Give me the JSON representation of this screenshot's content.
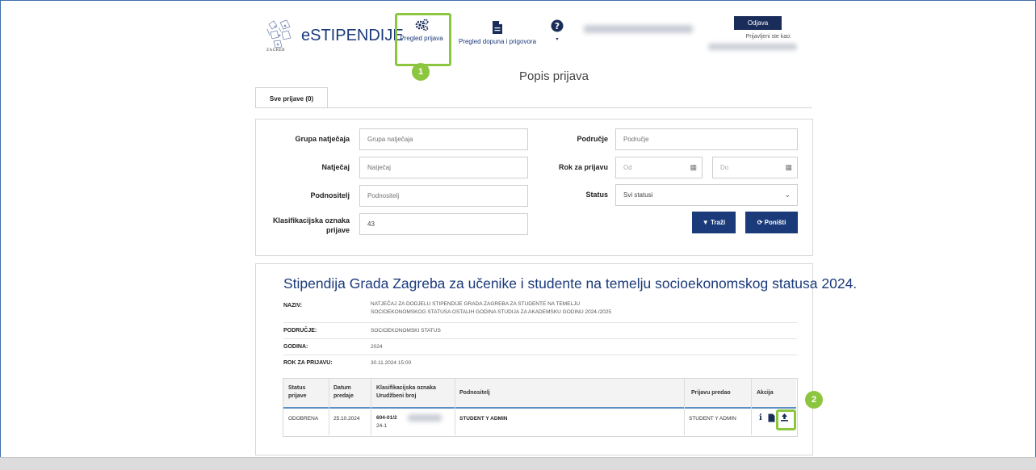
{
  "header": {
    "app_title": "eSTIPENDIJE",
    "city_logo_text": "ZAGREB",
    "nav": [
      {
        "label": "Pregled prijava",
        "icon": "gears-icon"
      },
      {
        "label": "Pregled dopuna i prigovora",
        "icon": "document-icon"
      },
      {
        "label": "",
        "icon": "help-icon"
      }
    ],
    "logout_label": "Odjava",
    "logged_in_label": "Prijavljeni ste kao:"
  },
  "callouts": [
    "1",
    "2"
  ],
  "page_title": "Popis prijava",
  "tabs": [
    {
      "label": "Sve prijave (0)"
    }
  ],
  "filters": {
    "grupa": {
      "label": "Grupa natječaja",
      "placeholder": "Grupa natječaja"
    },
    "natjecaj": {
      "label": "Natječaj",
      "placeholder": "Natječaj"
    },
    "podnositelj": {
      "label": "Podnositelj",
      "placeholder": "Podnositelj"
    },
    "klasifikacija": {
      "label": "Klasifikacijska oznaka prijave",
      "value": "43"
    },
    "podrucje": {
      "label": "Područje",
      "placeholder": "Područje"
    },
    "rok": {
      "label": "Rok za prijavu",
      "from_placeholder": "Od",
      "to_placeholder": "Do"
    },
    "status": {
      "label": "Status",
      "value": "Svi statusi"
    },
    "search_button": "Traži",
    "reset_button": "Poništi"
  },
  "competition": {
    "title": "Stipendija Grada Zagreba za učenike i studente na temelju socioekonomskog statusa 2024.",
    "naziv_label": "NAZIV:",
    "naziv_line1": "NATJEČAJ ZA DODJELU STIPENDIJE GRADA ZAGREBA ZA STUDENTE NA TEMELJU",
    "naziv_line2": "SOCIOEKONOMSKOG STATUSA OSTALIH GODINA STUDIJA ZA AKADEMSKU GODINU 2024./2025",
    "podrucje_label": "PODRUČJE:",
    "podrucje_value": "SOCIOEKONOMSKI STATUS",
    "godina_label": "GODINA:",
    "godina_value": "2024",
    "rok_label": "ROK ZA PRIJAVU:",
    "rok_value": "30.11.2024 15:00"
  },
  "table": {
    "headers": {
      "status_1": "Status",
      "status_2": "prijave",
      "datum_1": "Datum",
      "datum_2": "predaje",
      "klasa_1": "Klasifikacijska oznaka",
      "klasa_2": "Urudžbeni broj",
      "podnositelj": "Podnositelj",
      "predao": "Prijavu predao",
      "akcija": "Akcija"
    },
    "rows": [
      {
        "status": "ODOBRENA",
        "datum": "25.10.2024",
        "klasa": "604-01/2",
        "urbroj": "24-1",
        "podnositelj": "STUDENT Y ADMIN",
        "predao": "STUDENT Y ADMIN",
        "actions": [
          "info-icon",
          "document-icon",
          "upload-icon"
        ]
      }
    ]
  },
  "colors": {
    "primary": "#1a3a7a",
    "highlight": "#8cc63f"
  }
}
